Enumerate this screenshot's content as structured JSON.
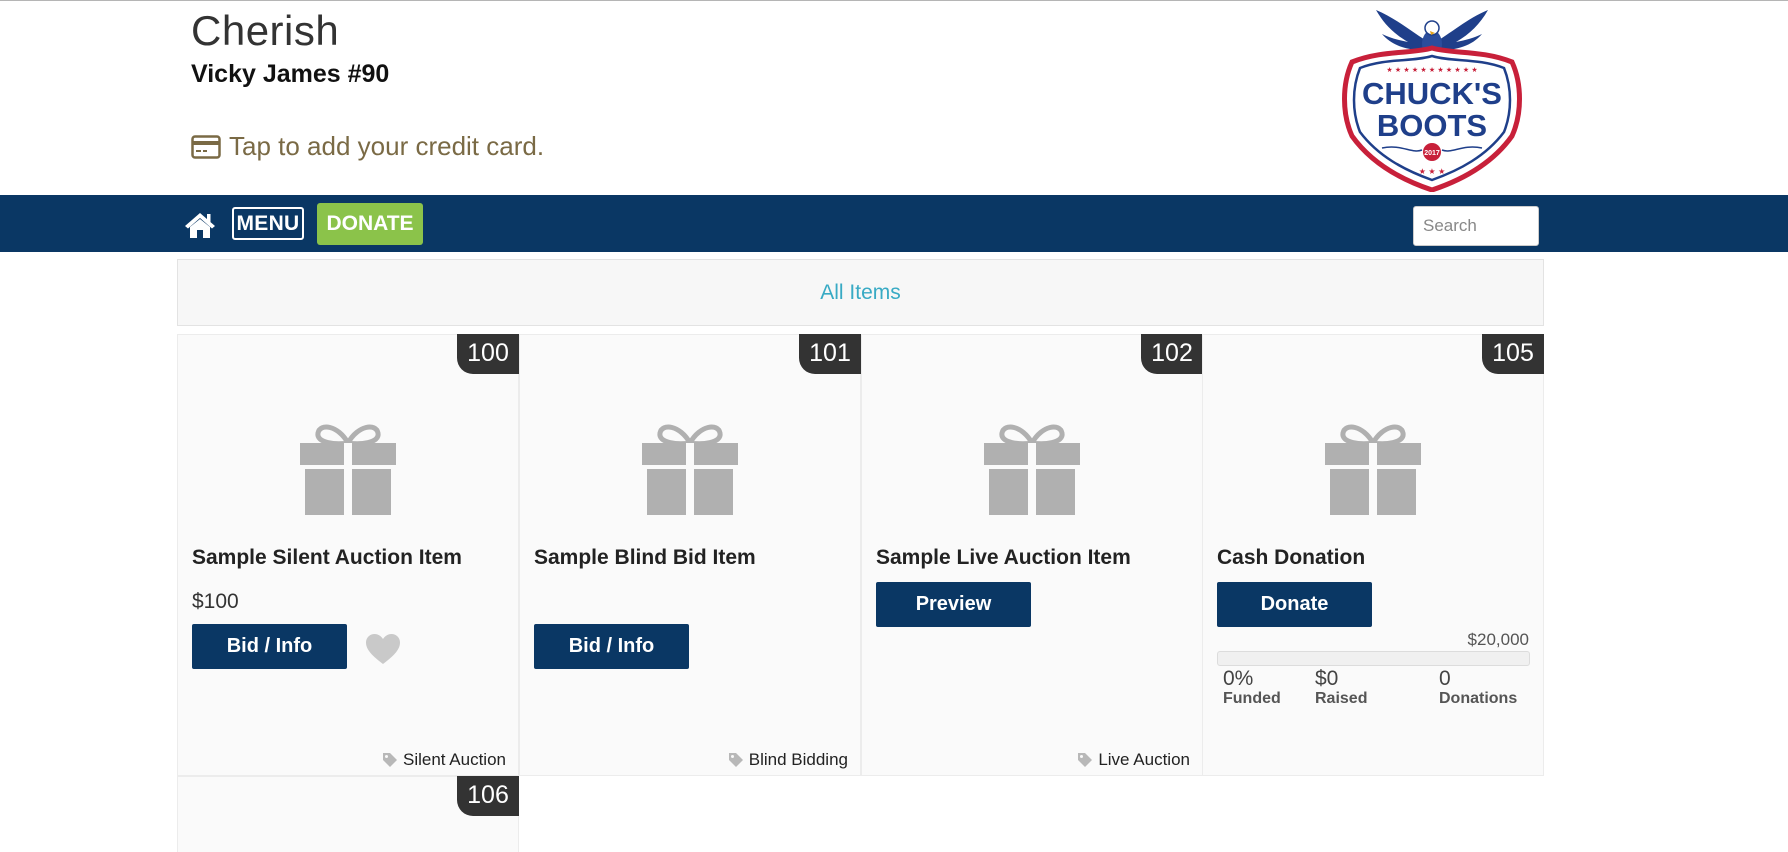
{
  "header": {
    "event_title": "Cherish",
    "user_line": "Vicky James #90",
    "credit_card_prompt": "Tap to add your credit card.",
    "logo_text_line1": "CHUCK'S",
    "logo_text_line2": "BOOTS",
    "logo_seal": "2017"
  },
  "nav": {
    "home_icon": "home-icon",
    "menu_label": "MENU",
    "donate_label": "DONATE",
    "search_placeholder": "Search"
  },
  "category": {
    "label": "All Items"
  },
  "items": [
    {
      "number": "100",
      "title": "Sample Silent Auction Item",
      "price": "$100",
      "button_label": "Bid / Info",
      "tag": "Silent Auction"
    },
    {
      "number": "101",
      "title": "Sample Blind Bid Item",
      "button_label": "Bid / Info",
      "tag": "Blind Bidding"
    },
    {
      "number": "102",
      "title": "Sample Live Auction Item",
      "button_label": "Preview",
      "tag": "Live Auction"
    },
    {
      "number": "105",
      "title": "Cash Donation",
      "button_label": "Donate",
      "goal": "$20,000",
      "funded_fraction": 0,
      "funded_value": "0%",
      "funded_label": "Funded",
      "raised_value": "$0",
      "raised_label": "Raised",
      "donations_value": "0",
      "donations_label": "Donations"
    },
    {
      "number": "106"
    }
  ],
  "colors": {
    "navbar": "#0a3764",
    "donate_green": "#8bc34a",
    "link_teal": "#38aac4",
    "card_link_brown": "#7a6a45",
    "badge": "#333333",
    "icon_gray": "#b0b0b0"
  }
}
